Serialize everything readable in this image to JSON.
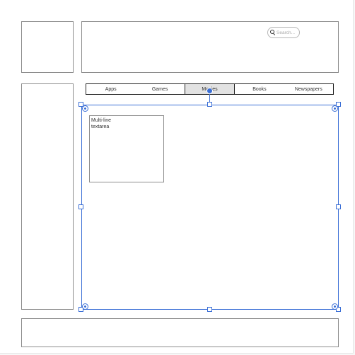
{
  "search": {
    "placeholder": "Search..."
  },
  "tabs": [
    {
      "label": "Apps",
      "active": false
    },
    {
      "label": "Games",
      "active": false
    },
    {
      "label": "Movies",
      "active": true
    },
    {
      "label": "Books",
      "active": false
    },
    {
      "label": "Newspapers",
      "active": false
    }
  ],
  "textarea": {
    "text": "Multi-line\ntextarea"
  },
  "colors": {
    "selection": "#3b6fd6",
    "active_tab": "#e2e2e2",
    "outline": "#8c8c8c"
  },
  "icons": {
    "search": "magnifier-icon"
  }
}
